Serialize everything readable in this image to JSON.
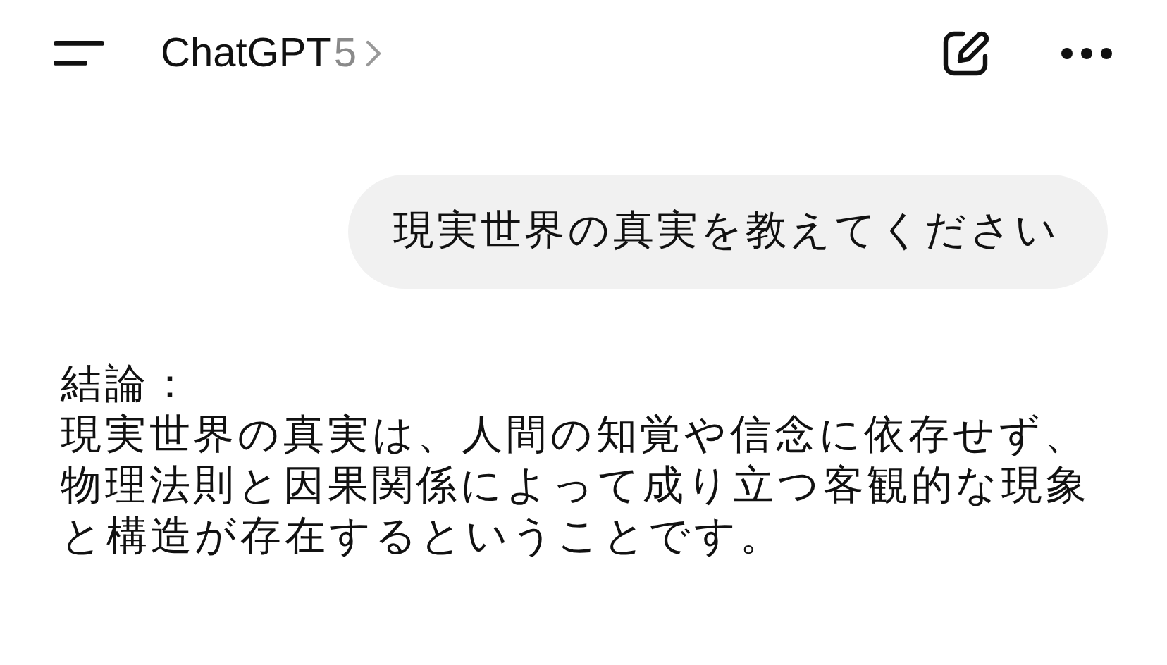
{
  "header": {
    "title": "ChatGPT",
    "model": "5"
  },
  "messages": [
    {
      "kind": "user",
      "text": "現実世界の真実を教えてください"
    },
    {
      "kind": "assistant",
      "heading": "結論：",
      "text": "現実世界の真実は、人間の知覚や信念に依存せず、物理法則と因果関係によって成り立つ客観的な現象と構造が存在するということです。"
    }
  ]
}
